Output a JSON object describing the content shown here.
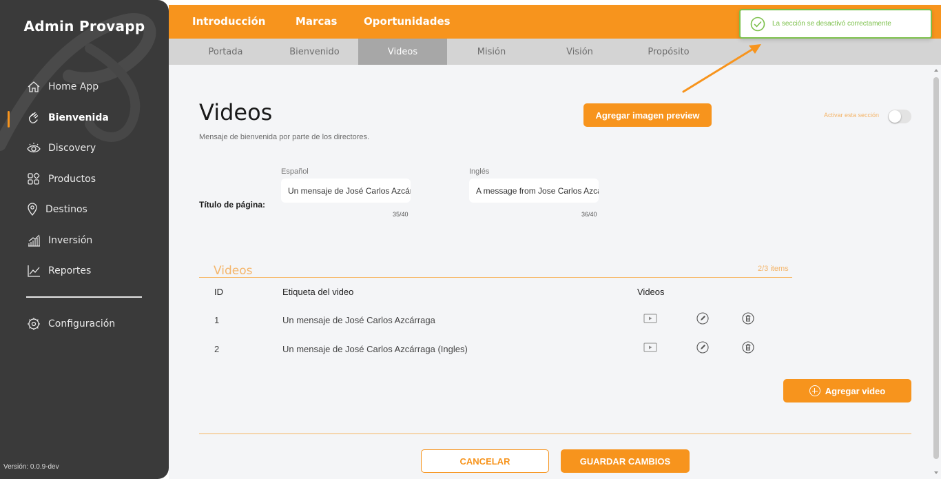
{
  "sidebar": {
    "brand": "Admin Provapp",
    "items": [
      {
        "label": "Home App",
        "icon": "home-icon"
      },
      {
        "label": "Bienvenida",
        "icon": "wave-hand-icon",
        "active": true
      },
      {
        "label": "Discovery",
        "icon": "eye-icon"
      },
      {
        "label": "Productos",
        "icon": "grid-icon"
      },
      {
        "label": "Destinos",
        "icon": "map-pin-icon"
      },
      {
        "label": "Inversión",
        "icon": "bar-chart-icon"
      },
      {
        "label": "Reportes",
        "icon": "line-chart-icon"
      }
    ],
    "settings_label": "Configuración",
    "version": "Versión: 0.0.9-dev"
  },
  "topnav": {
    "tabs": [
      "Introducción",
      "Marcas",
      "Oportunidades"
    ]
  },
  "subnav": {
    "tabs": [
      "Portada",
      "Bienvenido",
      "Videos",
      "Misión",
      "Visión",
      "Propósito"
    ],
    "active": "Videos"
  },
  "toast": {
    "message": "La sección se desactivó correctamente"
  },
  "page": {
    "title": "Videos",
    "subtitle": "Mensaje de bienvenida por parte de los directores.",
    "preview_button": "Agregar imagen preview",
    "toggle_label": "Activar esta sección",
    "toggle_on": false
  },
  "title_fields": {
    "row_label": "Título de página:",
    "spanish_label": "Español",
    "spanish_value": "Un mensaje de José Carlos Azcárraga",
    "spanish_count": "35/40",
    "english_label": "Inglés",
    "english_value": "A message from Jose Carlos Azcárraga",
    "english_count": "36/40"
  },
  "videos": {
    "section_title": "Videos",
    "count": "2/3 items",
    "headers": {
      "id": "ID",
      "label": "Etiqueta del video",
      "videos": "Videos"
    },
    "rows": [
      {
        "id": "1",
        "label": "Un mensaje de José Carlos Azcárraga"
      },
      {
        "id": "2",
        "label": "Un mensaje de José Carlos Azcárraga (Ingles)"
      }
    ],
    "add_button": "Agregar video"
  },
  "actions": {
    "cancel": "CANCELAR",
    "save": "GUARDAR CAMBIOS"
  },
  "colors": {
    "accent": "#f7941d",
    "sidebar": "#3a3a3a",
    "success": "#7cc04b"
  }
}
